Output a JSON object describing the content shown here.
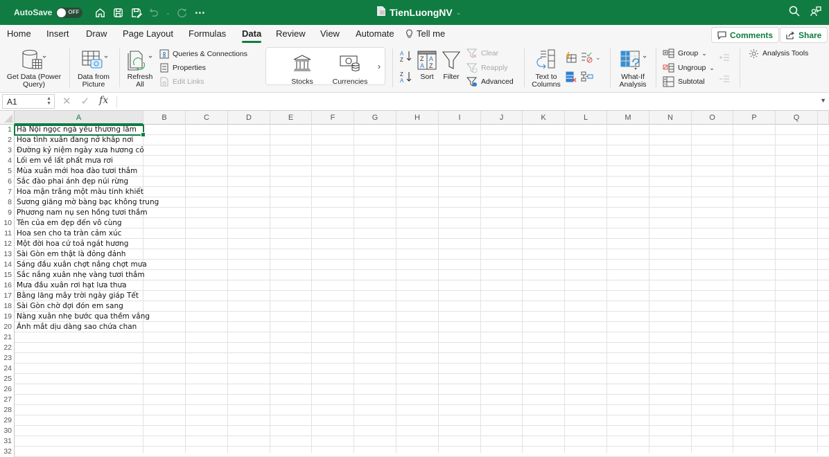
{
  "titlebar": {
    "autosave_label": "AutoSave",
    "autosave_state": "OFF",
    "document_title": "TienLuongNV",
    "icons": [
      "home-icon",
      "save-icon",
      "save-as-icon",
      "undo-icon",
      "redo-icon",
      "more-icon",
      "search-icon",
      "account-icon"
    ]
  },
  "tabs": [
    {
      "label": "Home"
    },
    {
      "label": "Insert"
    },
    {
      "label": "Draw"
    },
    {
      "label": "Page Layout"
    },
    {
      "label": "Formulas"
    },
    {
      "label": "Data",
      "active": true
    },
    {
      "label": "Review"
    },
    {
      "label": "View"
    },
    {
      "label": "Automate"
    },
    {
      "label": "Tell me"
    }
  ],
  "actions": {
    "comments_label": "Comments",
    "share_label": "Share"
  },
  "ribbon": {
    "get_data": "Get Data (Power Query)",
    "get_data_l1": "Get Data (Power",
    "get_data_l2": "Query)",
    "data_from_picture_l1": "Data from",
    "data_from_picture_l2": "Picture",
    "refresh_l1": "Refresh",
    "refresh_l2": "All",
    "queries_connections": "Queries & Connections",
    "properties": "Properties",
    "edit_links": "Edit Links",
    "stocks": "Stocks",
    "currencies": "Currencies",
    "sort": "Sort",
    "filter": "Filter",
    "clear": "Clear",
    "reapply": "Reapply",
    "advanced": "Advanced",
    "text_to_columns_l1": "Text to",
    "text_to_columns_l2": "Columns",
    "what_if_l1": "What-If",
    "what_if_l2": "Analysis",
    "group": "Group",
    "ungroup": "Ungroup",
    "subtotal": "Subtotal",
    "analysis_tools": "Analysis Tools"
  },
  "formula_bar": {
    "name_box": "A1",
    "formula": ""
  },
  "sheet": {
    "columns": [
      "A",
      "B",
      "C",
      "D",
      "E",
      "F",
      "G",
      "H",
      "I",
      "J",
      "K",
      "L",
      "M",
      "N",
      "O",
      "P",
      "Q"
    ],
    "selected_column": "A",
    "selected_row": 1,
    "rows": [
      "1",
      "2",
      "3",
      "4",
      "5",
      "6",
      "7",
      "8",
      "9",
      "10",
      "11",
      "12",
      "13",
      "14",
      "15",
      "16",
      "17",
      "18",
      "19",
      "20",
      "21",
      "22",
      "23",
      "24",
      "25",
      "26",
      "27",
      "28",
      "29",
      "30",
      "31",
      "32"
    ],
    "column_a": [
      "Hà Nội ngọc ngà yêu thương lắm",
      "Hoa tình xuân đang nở khắp nơi",
      "Đường kỷ niệm ngày xưa hương cỏ",
      "Lối em về lất phất mưa rơi",
      "Mùa xuân mới hoa đào tươi thắm",
      "Sắc đào phai ánh đẹp núi rừng",
      "Hoa mận trắng một màu tinh khiết",
      "Sương giăng mờ bàng bạc không trung",
      "Phương nam nụ sen hồng tươi thắm",
      "Tên của em đẹp đến vô cùng",
      "Hoa sen cho ta tràn cảm xúc",
      "Một đời hoa cứ toả ngát hương",
      "Sài Gòn em thật là đỏng đảnh",
      "Sáng đầu xuân chợt nắng chợt mưa",
      "Sắc nắng xuân nhẹ vàng tươi thắm",
      "Mưa đầu xuân rơi hạt lưa thưa",
      "Bằng lăng mây trời ngày giáp Tết",
      "Sài Gòn chờ đợi đón em sang",
      "Nàng xuân nhẹ bước qua thềm vắng",
      "Ánh mắt dịu dàng sao chứa chan"
    ]
  },
  "colors": {
    "brand": "#107c41",
    "ribbon_bg": "#f6f6f6",
    "gridline": "#e2e2e2"
  }
}
